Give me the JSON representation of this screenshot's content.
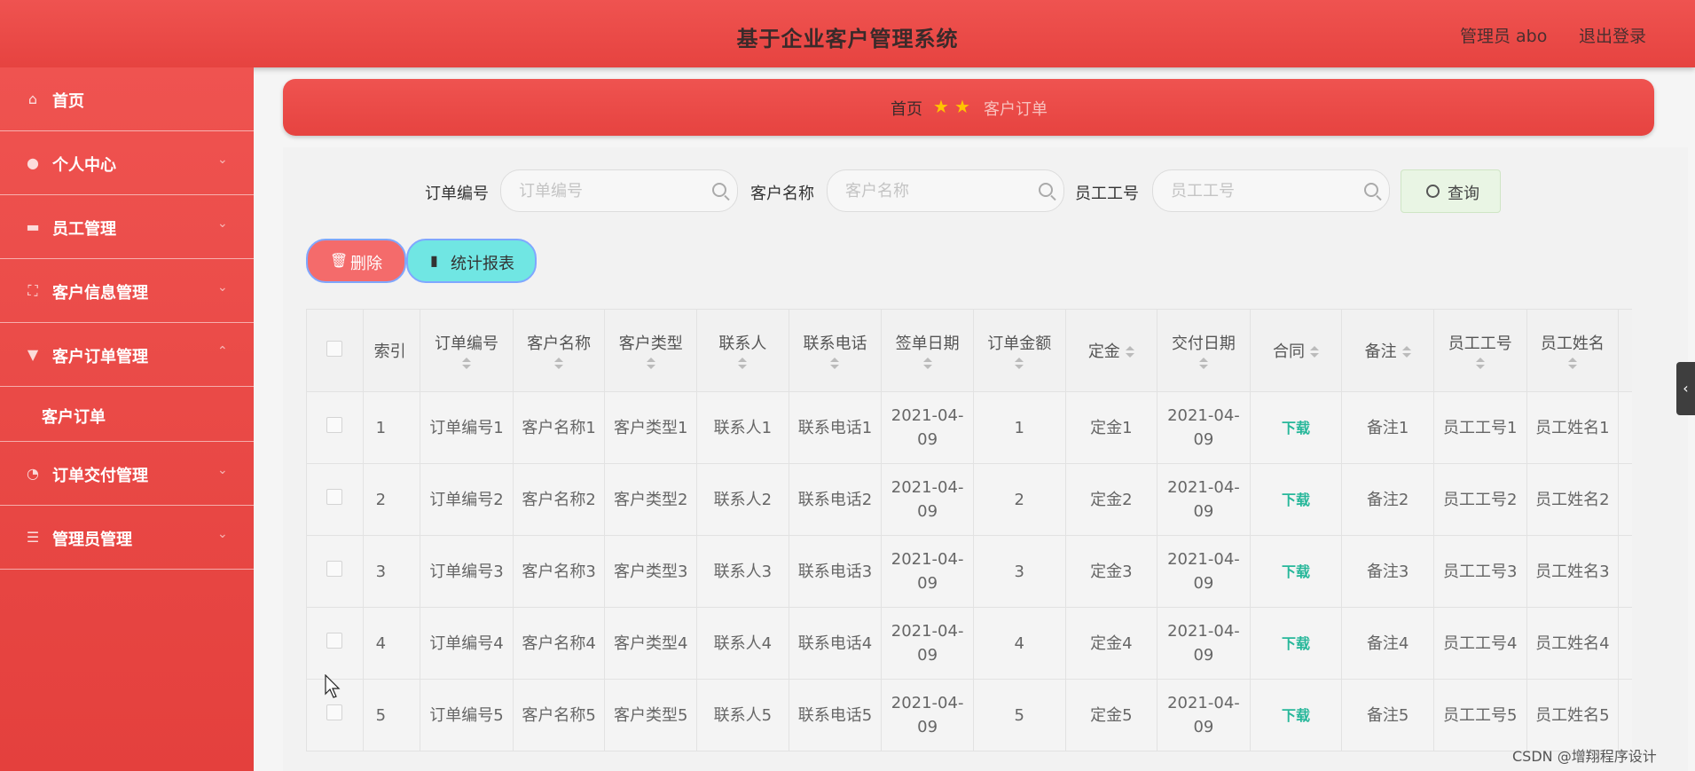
{
  "header": {
    "title": "基于企业客户管理系统",
    "user": "管理员 abo",
    "logout": "退出登录"
  },
  "sidebar": {
    "items": [
      {
        "label": "首页"
      },
      {
        "label": "个人中心"
      },
      {
        "label": "员工管理"
      },
      {
        "label": "客户信息管理"
      },
      {
        "label": "客户订单管理"
      },
      {
        "label": "订单交付管理"
      },
      {
        "label": "管理员管理"
      }
    ],
    "sub_items": [
      {
        "label": "客户订单"
      }
    ]
  },
  "breadcrumb": {
    "home": "首页",
    "current": "客户订单"
  },
  "search": {
    "order_no_label": "订单编号",
    "order_no_placeholder": "订单编号",
    "customer_name_label": "客户名称",
    "customer_name_placeholder": "客户名称",
    "emp_no_label": "员工工号",
    "emp_no_placeholder": "员工工号",
    "query_label": "查询"
  },
  "actions": {
    "delete_label": "删除",
    "stats_label": "统计报表"
  },
  "table": {
    "headers": [
      "索引",
      "订单编号",
      "客户名称",
      "客户类型",
      "联系人",
      "联系电话",
      "签单日期",
      "订单金额",
      "定金",
      "交付日期",
      "合同",
      "备注",
      "员工工号",
      "员工姓名"
    ],
    "download_label": "下载",
    "rows": [
      {
        "index": "1",
        "order_no": "订单编号1",
        "customer_name": "客户名称1",
        "customer_type": "客户类型1",
        "contact": "联系人1",
        "phone": "联系电话1",
        "sign_date": "2021-04-09",
        "amount": "1",
        "deposit": "定金1",
        "delivery_date": "2021-04-09",
        "remark": "备注1",
        "emp_no": "员工工号1",
        "emp_name": "员工姓名1"
      },
      {
        "index": "2",
        "order_no": "订单编号2",
        "customer_name": "客户名称2",
        "customer_type": "客户类型2",
        "contact": "联系人2",
        "phone": "联系电话2",
        "sign_date": "2021-04-09",
        "amount": "2",
        "deposit": "定金2",
        "delivery_date": "2021-04-09",
        "remark": "备注2",
        "emp_no": "员工工号2",
        "emp_name": "员工姓名2"
      },
      {
        "index": "3",
        "order_no": "订单编号3",
        "customer_name": "客户名称3",
        "customer_type": "客户类型3",
        "contact": "联系人3",
        "phone": "联系电话3",
        "sign_date": "2021-04-09",
        "amount": "3",
        "deposit": "定金3",
        "delivery_date": "2021-04-09",
        "remark": "备注3",
        "emp_no": "员工工号3",
        "emp_name": "员工姓名3"
      },
      {
        "index": "4",
        "order_no": "订单编号4",
        "customer_name": "客户名称4",
        "customer_type": "客户类型4",
        "contact": "联系人4",
        "phone": "联系电话4",
        "sign_date": "2021-04-09",
        "amount": "4",
        "deposit": "定金4",
        "delivery_date": "2021-04-09",
        "remark": "备注4",
        "emp_no": "员工工号4",
        "emp_name": "员工姓名4"
      },
      {
        "index": "5",
        "order_no": "订单编号5",
        "customer_name": "客户名称5",
        "customer_type": "客户类型5",
        "contact": "联系人5",
        "phone": "联系电话5",
        "sign_date": "2021-04-09",
        "amount": "5",
        "deposit": "定金5",
        "delivery_date": "2021-04-09",
        "remark": "备注5",
        "emp_no": "员工工号5",
        "emp_name": "员工姓名5"
      }
    ]
  },
  "watermark": "CSDN @增翔程序设计",
  "colors": {
    "primary": "#e64340",
    "query_bg": "#e9f5e4",
    "delete_bg": "#f46b6b",
    "stats_bg": "#70e6e3",
    "download": "#27b79a"
  }
}
